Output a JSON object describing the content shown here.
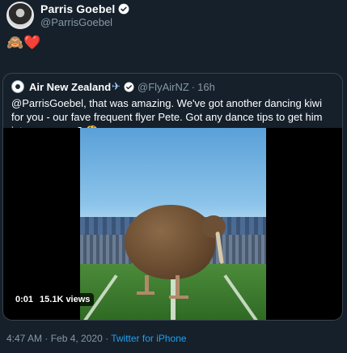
{
  "tweet": {
    "author_name": "Parris Goebel",
    "author_handle": "@ParrisGoebel",
    "emoji_text": "🙈❤️",
    "timestamp": "4:47 AM · Feb 4, 2020",
    "separator": " · ",
    "source": "Twitter for iPhone"
  },
  "quoted": {
    "name": "Air New Zealand",
    "plane_glyph": "✈",
    "handle": "@FlyAirNZ",
    "dot": "·",
    "time": "16h",
    "text": "@ParrisGoebel, that was amazing. We've got another dancing kiwi for you - our fave frequent flyer Pete. Got any dance tips to get him into your crew? 🤔"
  },
  "video": {
    "time": "0:01",
    "views": "15.1K views"
  },
  "colors": {
    "background": "#15202b",
    "secondary_text": "#8899a6",
    "link": "#1da1f2",
    "border": "#38444d"
  },
  "icons": {
    "verified": "verified-badge-icon",
    "plane": "airplane-icon"
  }
}
